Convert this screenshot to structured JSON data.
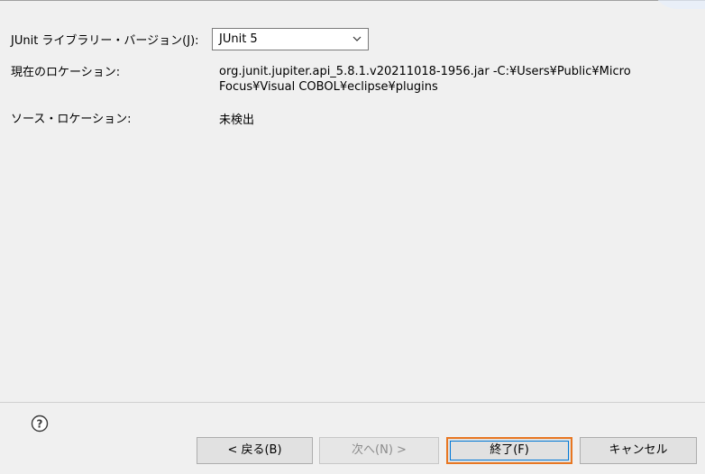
{
  "form": {
    "version_label": "JUnit ライブラリー・バージョン(J):",
    "version_value": "JUnit 5",
    "location_label": "現在のロケーション:",
    "location_value": "org.junit.jupiter.api_5.8.1.v20211018-1956.jar -C:¥Users¥Public¥Micro Focus¥Visual COBOL¥eclipse¥plugins",
    "source_label": "ソース・ロケーション:",
    "source_value": "未検出"
  },
  "buttons": {
    "back": "< 戻る(B)",
    "next": "次へ(N) >",
    "finish": "終了(F)",
    "cancel": "キャンセル"
  },
  "icons": {
    "help": "help-icon",
    "dropdown": "chevron-down-icon"
  },
  "colors": {
    "background": "#f0f0f0",
    "focus_outline": "#e87722",
    "focus_inner": "#0078d7",
    "disabled_text": "#8c8c8c"
  }
}
